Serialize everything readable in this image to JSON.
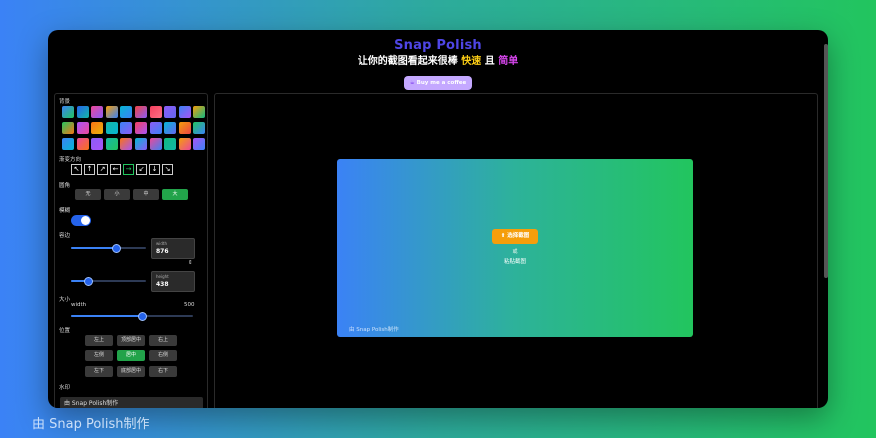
{
  "app": {
    "title": "Snap Polish",
    "subtitle_prefix": "让你的截图看起来很棒",
    "subtitle_fast": "快速",
    "subtitle_and": "且",
    "subtitle_simple": "简单",
    "coffee_button": "Buy me a coffee"
  },
  "sidebar": {
    "background_label": "背景",
    "direction_label": "渐变方向",
    "directions": [
      "↖",
      "↑",
      "↗",
      "←",
      "→",
      "↙",
      "↓",
      "↘"
    ],
    "radius_label": "圆角",
    "radius_options": [
      "无",
      "小",
      "中",
      "大"
    ],
    "radius_selected": "大",
    "blur_label": "模糊",
    "blur_on": true,
    "padding_label": "容边",
    "padding_width_label": "width",
    "padding_width_value": "876",
    "padding_height_label": "height",
    "padding_height_value": "438",
    "padding_width_level": 0.6,
    "padding_height_level": 0.22,
    "link_icon": "⇕",
    "size_label": "大小",
    "size_width_label": "width",
    "size_width_value": "500",
    "size_level": 0.58,
    "position_label": "位置",
    "positions": [
      "左上",
      "顶部居中",
      "右上",
      "左侧",
      "居中",
      "右侧",
      "左下",
      "底部居中",
      "右下"
    ],
    "position_selected": "居中",
    "watermark_label": "水印",
    "watermark_value": "由 Snap Polish制作"
  },
  "canvas": {
    "choose_button": "⬆ 选择截图",
    "or_text": "或",
    "paste_text": "粘贴截图",
    "watermark": "由 Snap Polish制作"
  },
  "page_watermark": "由 Snap Polish制作",
  "colors": {
    "accent": "#3b82f6",
    "active": "#22a34a",
    "title": "#4f46e5",
    "fast": "#facc15",
    "simple": "#d946ef",
    "choose": "#f59e0b"
  }
}
